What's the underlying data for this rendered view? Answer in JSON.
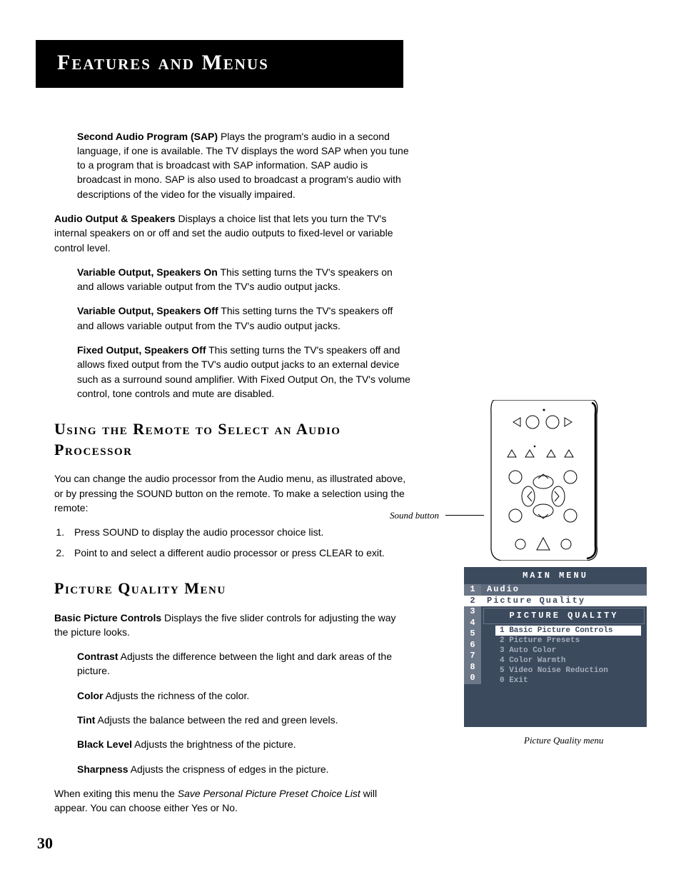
{
  "header": {
    "title": "Features and Menus"
  },
  "sap": {
    "term": "Second Audio Program (SAP)",
    "text": "  Plays the program's audio in a second language, if one is available. The TV displays the word SAP when you tune to a program that is broadcast with SAP information. SAP audio is broadcast in mono. SAP is also used to broadcast a program's audio with descriptions of the video for the visually impaired."
  },
  "audio_out": {
    "term": "Audio Output & Speakers",
    "text": "   Displays a choice list that lets you turn the TV's internal speakers on or off and set the audio outputs to fixed-level or variable control level.",
    "subs": [
      {
        "term": "Variable Output, Speakers On",
        "text": " This setting turns the TV's speakers on and allows variable output from the TV's audio output jacks."
      },
      {
        "term": "Variable Output, Speakers Off",
        "text": " This setting turns the TV's speakers off and allows variable output from the TV's audio output jacks."
      },
      {
        "term": "Fixed Output, Speakers Off",
        "text": " This setting turns the TV's speakers off and allows fixed output from the TV's audio output jacks to an external device such as a surround sound amplifier. With Fixed Output On, the TV's volume control, tone controls and mute are disabled."
      }
    ]
  },
  "heading_remote": "Using the Remote to Select an Audio Processor",
  "remote_intro": "You can change the audio processor from the Audio menu, as illustrated above, or by pressing the SOUND button on the remote. To make a selection using the remote:",
  "remote_steps": [
    "Press SOUND to display the audio processor choice list.",
    "Point to and select a different audio processor or press CLEAR to exit."
  ],
  "remote_caption": "Sound button",
  "heading_picture": "Picture Quality Menu",
  "picture_intro": {
    "term": "Basic Picture Controls",
    "text": "   Displays the five slider controls for adjusting the way the picture looks."
  },
  "picture_subs": [
    {
      "term": "Contrast",
      "text": "   Adjusts the difference between the light and dark areas of the picture."
    },
    {
      "term": "Color",
      "text": "   Adjusts the richness of the color."
    },
    {
      "term": "Tint",
      "text": "  Adjusts the balance between the red and green levels."
    },
    {
      "term": "Black Level",
      "text": "  Adjusts the brightness of the picture."
    },
    {
      "term": "Sharpness",
      "text": "  Adjusts the crispness of edges in the picture."
    }
  ],
  "exit_text_a": "When exiting this menu the ",
  "exit_text_b": "Save Personal Picture Preset Choice List",
  "exit_text_c": " will appear. You can choose either Yes or No.",
  "page_number": "30",
  "menu": {
    "title": "MAIN MENU",
    "left_nums": [
      "1",
      "2",
      "3",
      "4",
      "5",
      "6",
      "7",
      "8",
      "0"
    ],
    "left_active_index": 1,
    "top_items": [
      "Audio",
      "Picture Quality"
    ],
    "subtitle": "PICTURE QUALITY",
    "sub_items": [
      "1 Basic Picture Controls",
      "2 Picture Presets",
      "3 Auto Color",
      "4 Color Warmth",
      "5 Video Noise Reduction",
      "0 Exit"
    ],
    "caption": "Picture Quality menu"
  }
}
